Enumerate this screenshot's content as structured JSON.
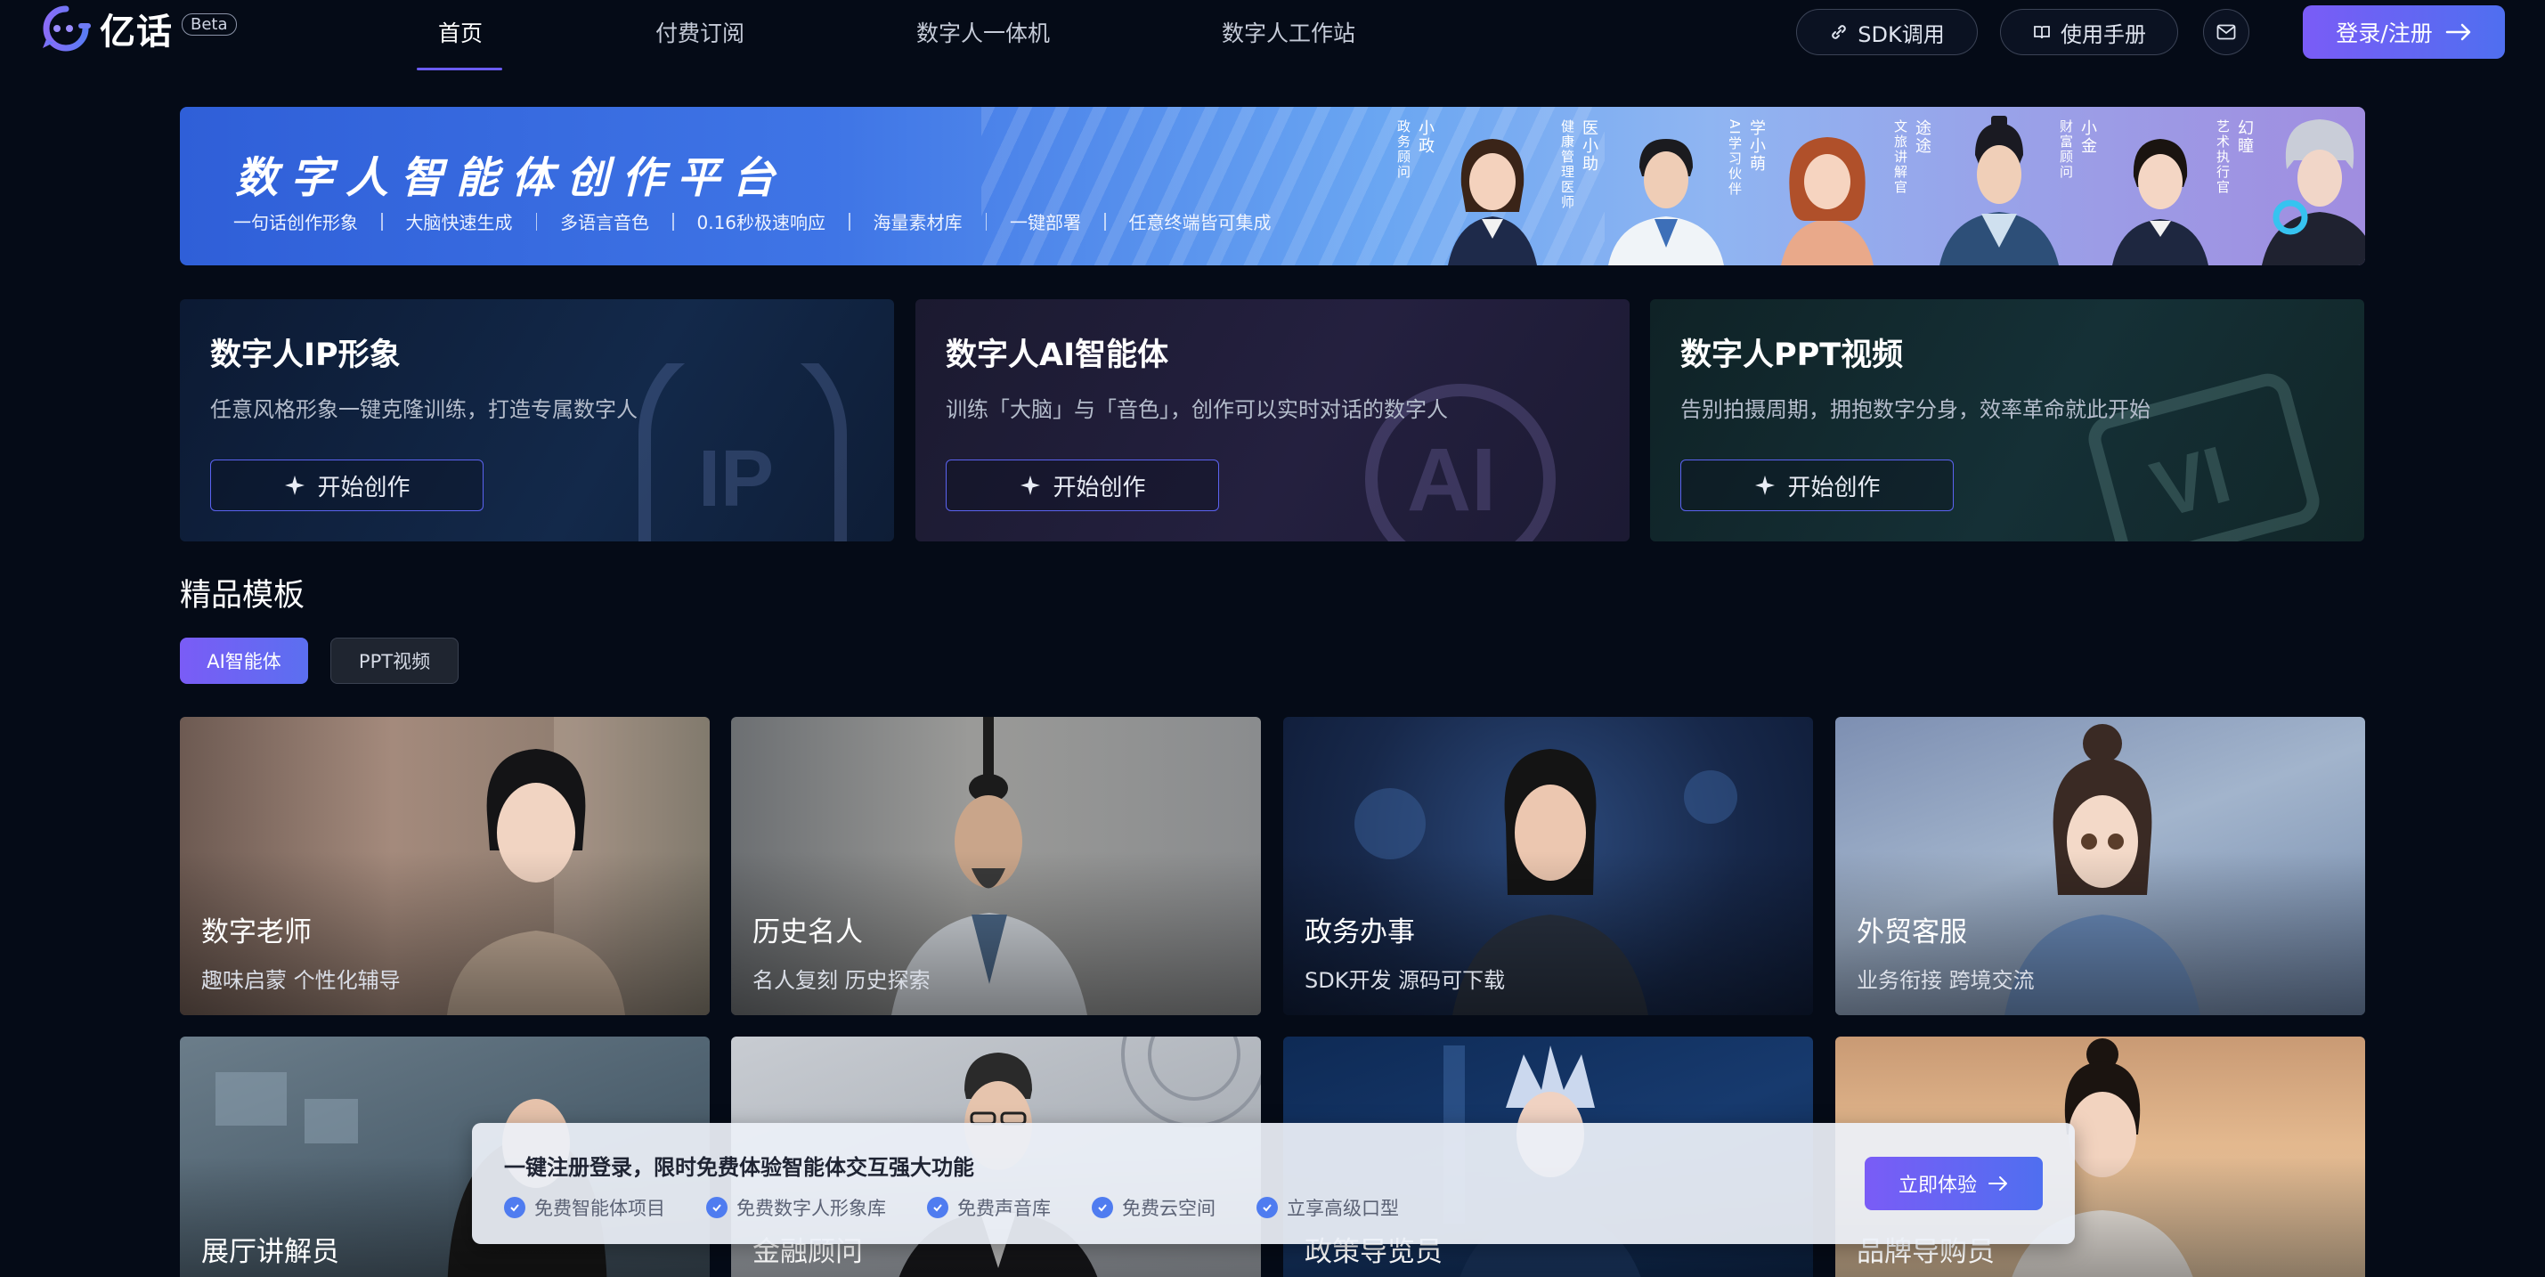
{
  "brand": {
    "name": "亿话",
    "badge": "Beta"
  },
  "nav": [
    {
      "label": "首页",
      "active": true
    },
    {
      "label": "付费订阅",
      "active": false
    },
    {
      "label": "数字人一体机",
      "active": false
    },
    {
      "label": "数字人工作站",
      "active": false
    }
  ],
  "header_actions": {
    "sdk": "SDK调用",
    "manual": "使用手册",
    "mail_icon": "mail-icon",
    "login": "登录/注册"
  },
  "banner": {
    "title": "数字人智能体创作平台",
    "features": [
      "一句话创作形象",
      "大脑快速生成",
      "多语言音色",
      "0.16秒极速响应",
      "海量素材库",
      "一键部署",
      "任意终端皆可集成"
    ],
    "personas": [
      {
        "name": "小政",
        "role": "政务顾问"
      },
      {
        "name": "医小助",
        "role": "健康管理医师"
      },
      {
        "name": "学小萌",
        "role": "AI学习伙伴"
      },
      {
        "name": "途途",
        "role": "文旅讲解官"
      },
      {
        "name": "小金",
        "role": "财富顾问"
      },
      {
        "name": "幻瞳",
        "role": "艺术执行官"
      }
    ]
  },
  "feature_cards": [
    {
      "title": "数字人IP形象",
      "desc": "任意风格形象一键克隆训练，打造专属数字人",
      "button": "开始创作"
    },
    {
      "title": "数字人AI智能体",
      "desc": "训练「大脑」与「音色」，创作可以实时对话的数字人",
      "button": "开始创作"
    },
    {
      "title": "数字人PPT视频",
      "desc": "告别拍摄周期，拥抱数字分身，效率革命就此开始",
      "button": "开始创作"
    }
  ],
  "templates": {
    "title": "精品模板",
    "tabs": [
      {
        "label": "AI智能体",
        "active": true
      },
      {
        "label": "PPT视频",
        "active": false
      }
    ],
    "cards": [
      {
        "name": "数字老师",
        "desc": "趣味启蒙 个性化辅导"
      },
      {
        "name": "历史名人",
        "desc": "名人复刻 历史探索"
      },
      {
        "name": "政务办事",
        "desc": "SDK开发 源码可下载"
      },
      {
        "name": "外贸客服",
        "desc": "业务衔接 跨境交流"
      },
      {
        "name": "展厅讲解员",
        "desc": ""
      },
      {
        "name": "金融顾问",
        "desc": ""
      },
      {
        "name": "政策导览员",
        "desc": ""
      },
      {
        "name": "品牌导购员",
        "desc": ""
      }
    ]
  },
  "promo": {
    "title": "一键注册登录，限时免费体验智能体交互强大功能",
    "items": [
      "免费智能体项目",
      "免费数字人形象库",
      "免费声音库",
      "免费云空间",
      "立享高级口型"
    ],
    "button": "立即体验"
  },
  "colors": {
    "background": "#050b17",
    "accent": "#6b5cf6",
    "accent2": "#4f6ff0"
  }
}
